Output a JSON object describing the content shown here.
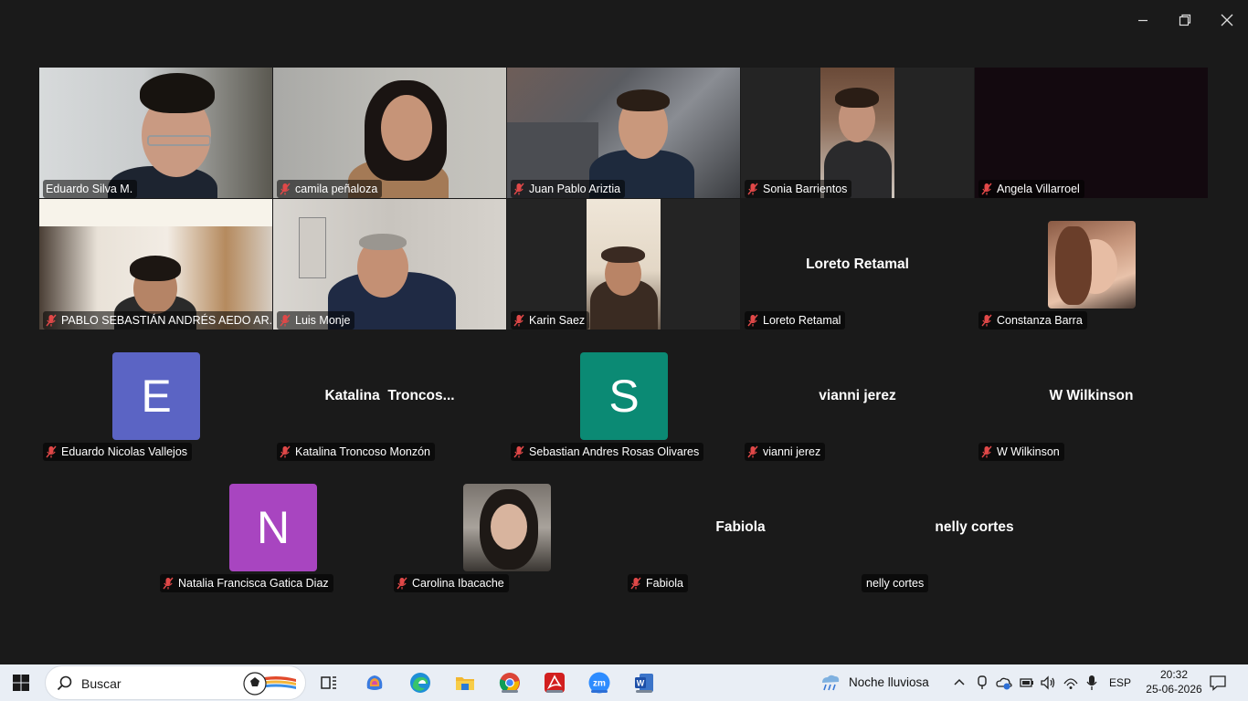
{
  "window": {
    "controls": [
      "minimize-icon",
      "restore-icon",
      "close-icon"
    ]
  },
  "tiles": [
    {
      "name": "Eduardo Silva M.",
      "muted": false
    },
    {
      "name": "camila peñaloza",
      "muted": true
    },
    {
      "name": "Juan Pablo Ariztia",
      "muted": true
    },
    {
      "name": "Sonia Barrientos",
      "muted": true
    },
    {
      "name": "Angela Villarroel",
      "muted": true
    },
    {
      "name": "PABLO SEBASTIÁN ANDRÉS AEDO AR...",
      "muted": true
    },
    {
      "name": "Luis Monje",
      "muted": true
    },
    {
      "name": "Karin Saez",
      "muted": true
    },
    {
      "name": "Loreto Retamal",
      "display": "Loreto Retamal",
      "muted": true
    },
    {
      "name": "Constanza Barra",
      "muted": true
    },
    {
      "name": "Eduardo Nicolas Vallejos",
      "initial": "E",
      "muted": true
    },
    {
      "name": "Katalina Troncoso Monzón",
      "display": "Katalina  Troncos...",
      "muted": true
    },
    {
      "name": "Sebastian Andres Rosas Olivares",
      "initial": "S",
      "muted": true
    },
    {
      "name": "vianni jerez",
      "display": "vianni jerez",
      "muted": true
    },
    {
      "name": "W Wilkinson",
      "display": "W Wilkinson",
      "muted": true
    },
    {
      "name": "Natalia Francisca Gatica Diaz",
      "initial": "N",
      "muted": true
    },
    {
      "name": "Carolina Ibacache",
      "muted": true
    },
    {
      "name": "Fabiola",
      "display": "Fabiola",
      "muted": true
    },
    {
      "name": "nelly cortes",
      "display": "nelly cortes",
      "muted": false
    }
  ],
  "colors": {
    "active_speaker": "#3ecf6b",
    "avatar_E": "#5b64c4",
    "avatar_S": "#0b8a74",
    "avatar_N": "#a845c0",
    "mic_muted": "#e04848"
  },
  "taskbar": {
    "search_placeholder": "Buscar",
    "weather": "Noche lluviosa",
    "language": "ESP",
    "time": "20:32",
    "date": "25-06-2026",
    "apps": [
      "task-view-icon",
      "copilot-icon",
      "edge-icon",
      "file-explorer-icon",
      "chrome-icon",
      "acrobat-icon",
      "zoom-icon",
      "word-icon"
    ]
  }
}
